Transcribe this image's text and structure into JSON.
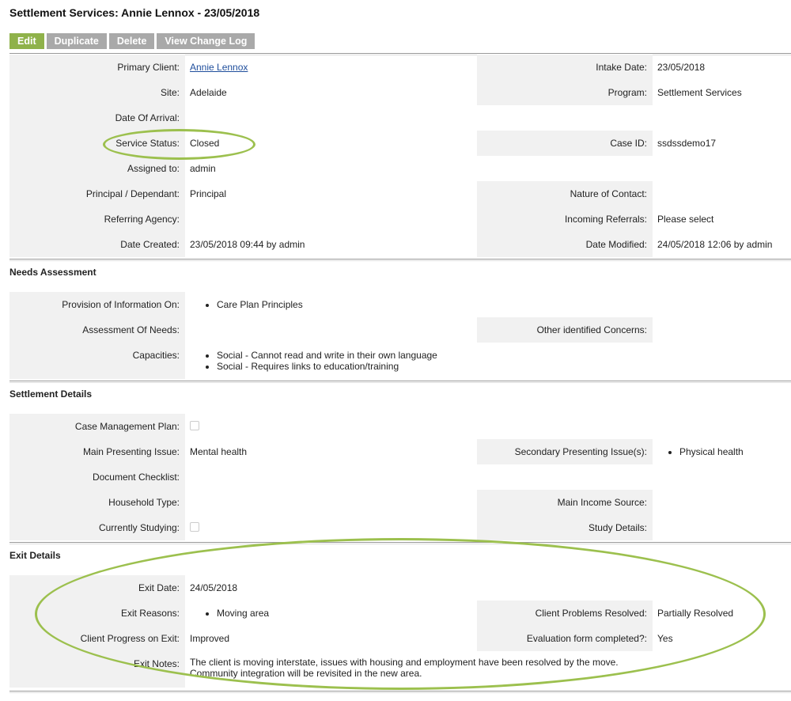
{
  "title": "Settlement Services: Annie Lennox - 23/05/2018",
  "toolbar": {
    "edit": "Edit",
    "duplicate": "Duplicate",
    "delete": "Delete",
    "changelog": "View Change Log"
  },
  "main": {
    "primary_client_label": "Primary Client:",
    "primary_client": "Annie Lennox",
    "intake_date_label": "Intake Date:",
    "intake_date": "23/05/2018",
    "site_label": "Site:",
    "site": "Adelaide",
    "program_label": "Program:",
    "program": "Settlement Services",
    "date_of_arrival_label": "Date Of Arrival:",
    "service_status_label": "Service Status:",
    "service_status": "Closed",
    "case_id_label": "Case ID:",
    "case_id": "ssdssdemo17",
    "assigned_to_label": "Assigned to:",
    "assigned_to": "admin",
    "principal_label": "Principal / Dependant:",
    "principal": "Principal",
    "nature_contact_label": "Nature of Contact:",
    "referring_agency_label": "Referring Agency:",
    "incoming_referrals_label": "Incoming Referrals:",
    "incoming_referrals": "Please select",
    "date_created_label": "Date Created:",
    "date_created": "23/05/2018 09:44 by admin",
    "date_modified_label": "Date Modified:",
    "date_modified": "24/05/2018 12:06 by admin"
  },
  "needs": {
    "heading": "Needs Assessment",
    "provision_label": "Provision of Information On:",
    "provision": [
      "Care Plan Principles"
    ],
    "assessment_label": "Assessment Of Needs:",
    "other_concerns_label": "Other identified Concerns:",
    "capacities_label": "Capacities:",
    "capacities": [
      "Social - Cannot read and write in their own language",
      "Social - Requires links to education/training"
    ]
  },
  "settlement": {
    "heading": "Settlement Details",
    "case_mgmt_label": "Case Management Plan:",
    "main_issue_label": "Main Presenting Issue:",
    "main_issue": "Mental health",
    "secondary_issue_label": "Secondary Presenting Issue(s):",
    "secondary_issue": [
      "Physical health"
    ],
    "doc_checklist_label": "Document Checklist:",
    "household_label": "Household Type:",
    "income_label": "Main Income Source:",
    "studying_label": "Currently Studying:",
    "study_details_label": "Study Details:"
  },
  "exit": {
    "heading": "Exit Details",
    "exit_date_label": "Exit Date:",
    "exit_date": "24/05/2018",
    "exit_reasons_label": "Exit Reasons:",
    "exit_reasons": [
      "Moving area"
    ],
    "problems_resolved_label": "Client Problems Resolved:",
    "problems_resolved": "Partially Resolved",
    "progress_label": "Client Progress on Exit:",
    "progress": "Improved",
    "eval_label": "Evaluation form completed?:",
    "eval": "Yes",
    "notes_label": "Exit Notes:",
    "notes_line1": "The client is moving interstate, issues with housing and employment have been resolved by the move.",
    "notes_line2": "Community integration will be revisited in the new area."
  },
  "colors": {
    "accent": "#8fb24a",
    "button": "#a9a9a9",
    "label_bg": "#f1f1f1",
    "highlight": "#9cc04e",
    "link": "#1f4e9c"
  }
}
